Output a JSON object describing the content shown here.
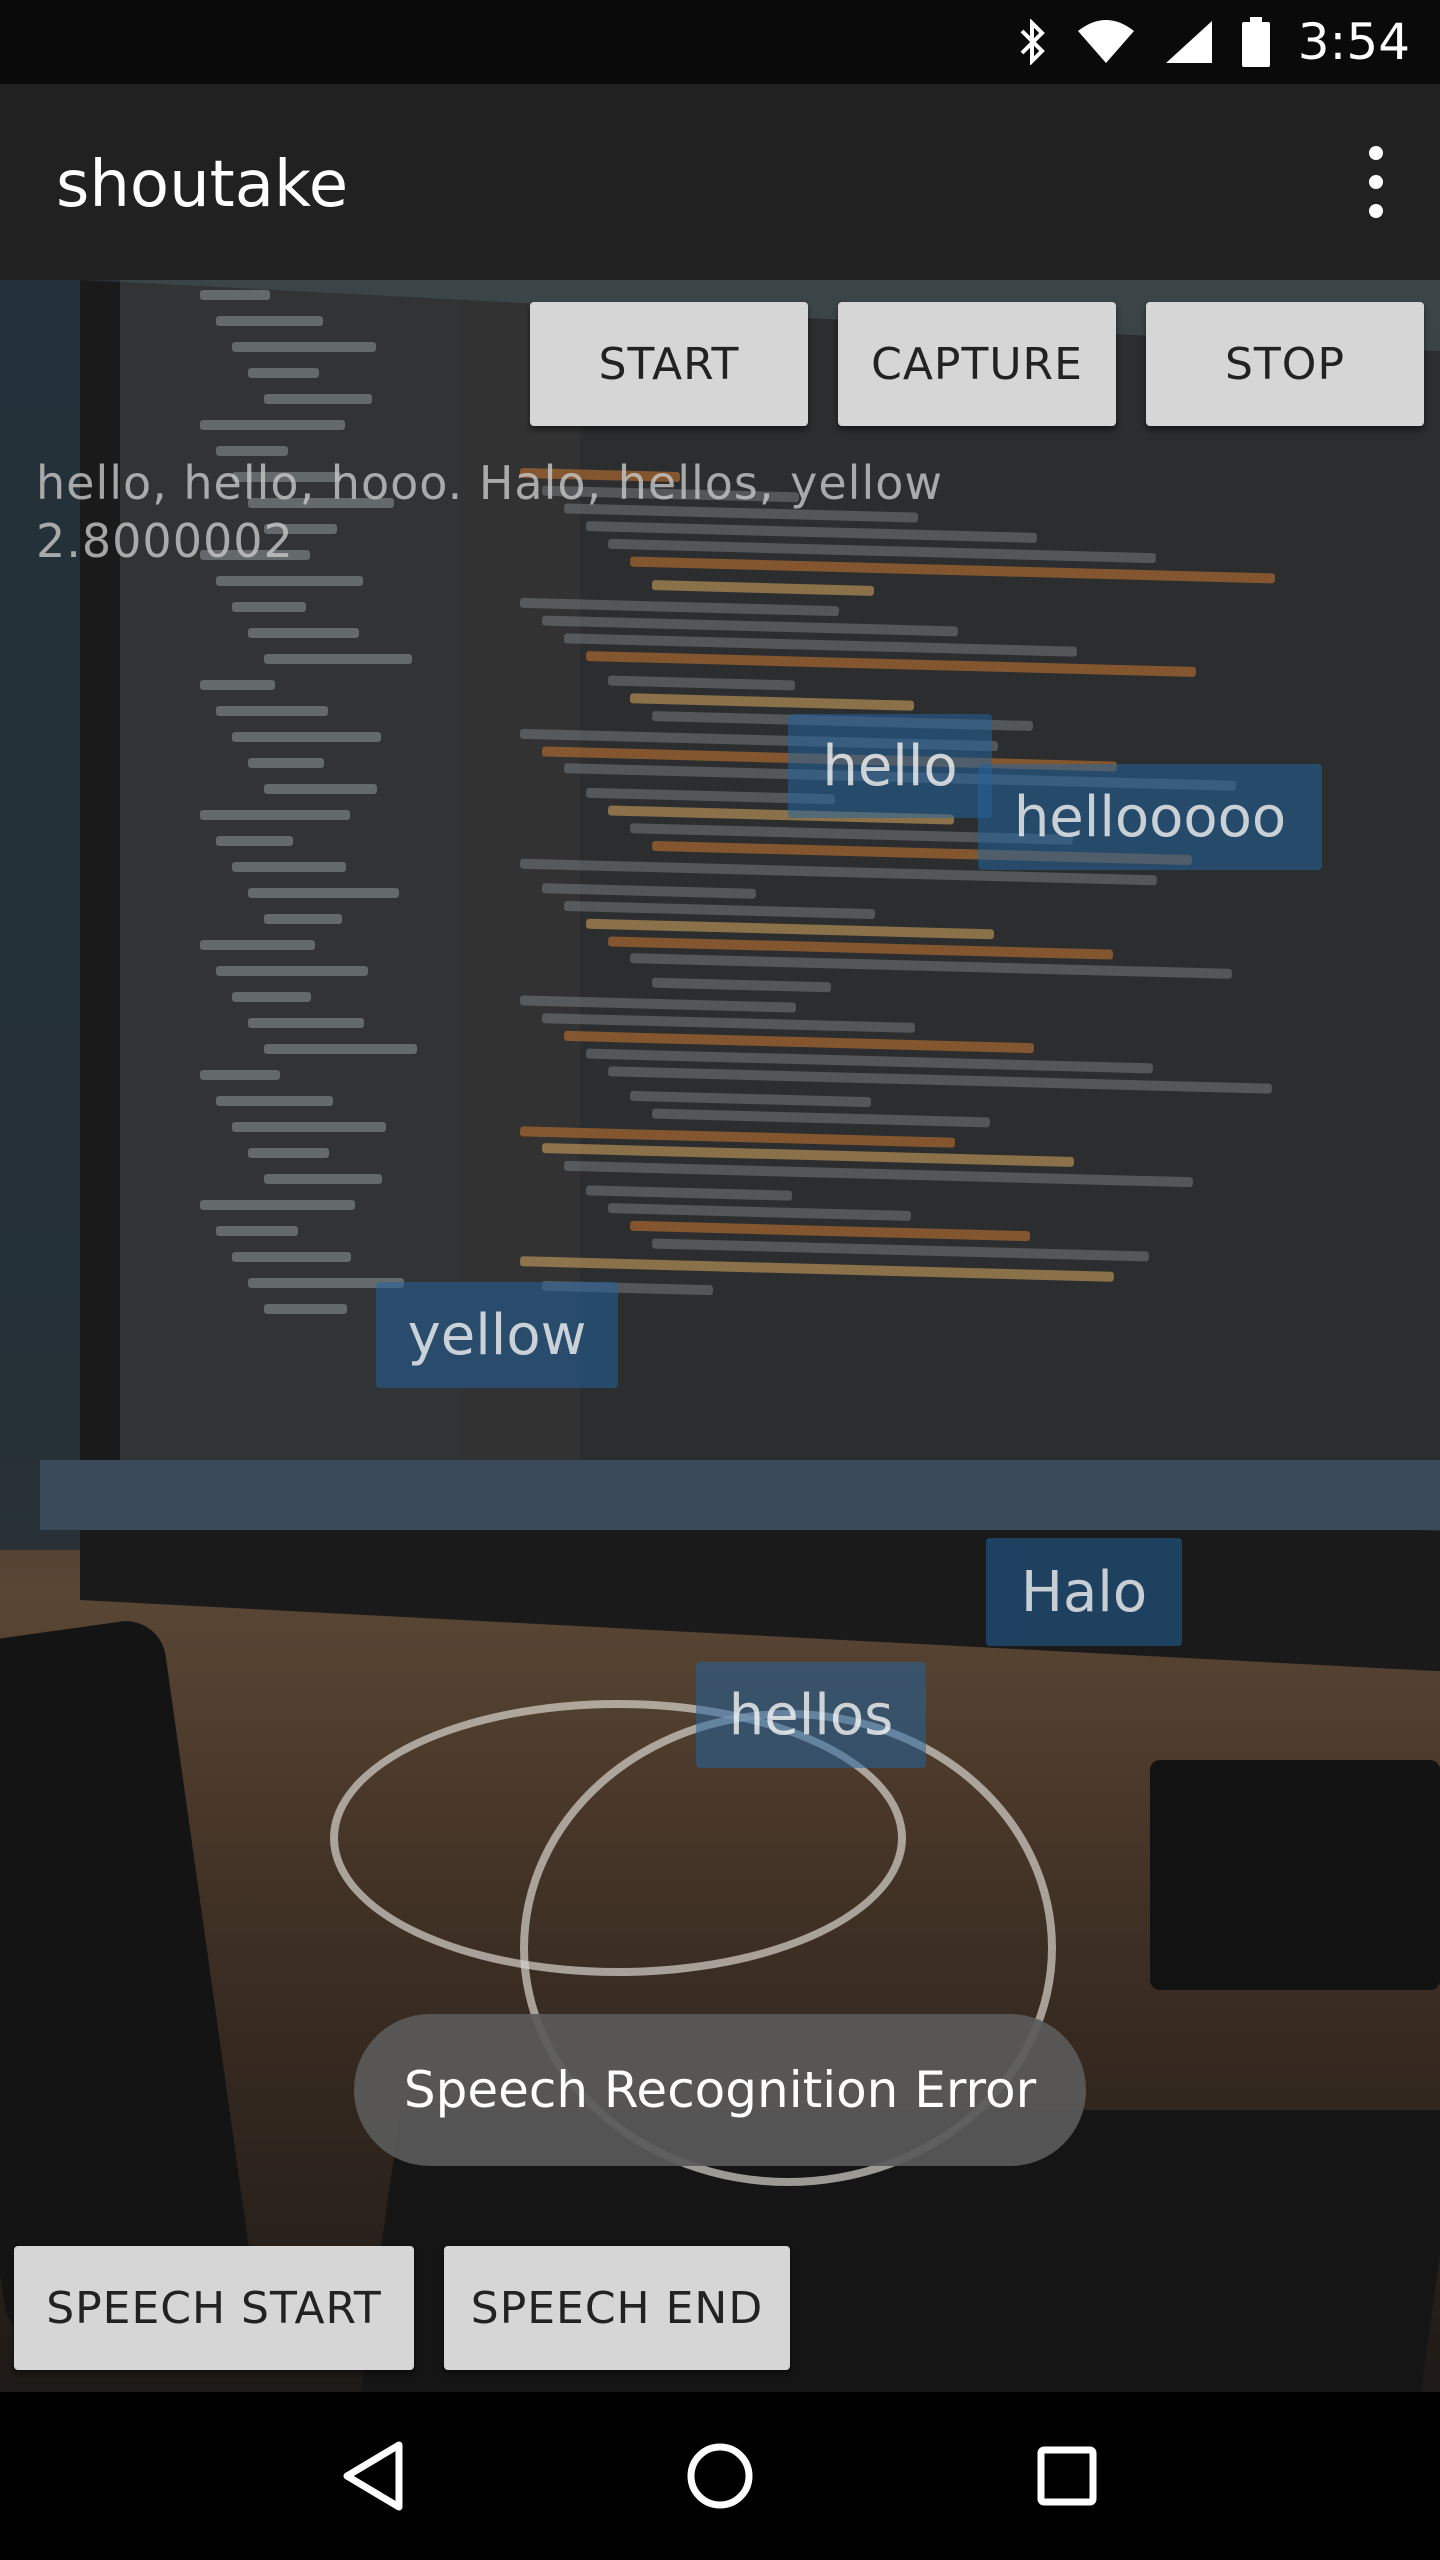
{
  "status_bar": {
    "time": "3:54",
    "icons": [
      "bluetooth-icon",
      "wifi-icon",
      "signal-icon",
      "battery-icon"
    ]
  },
  "app_bar": {
    "title": "shoutake",
    "overflow_icon": "overflow-menu-icon"
  },
  "controls": {
    "start_label": "START",
    "capture_label": "CAPTURE",
    "stop_label": "STOP"
  },
  "transcript": {
    "text": "hello, hello, hooo. Halo, hellos, yellow",
    "score": "2.8000002"
  },
  "floating_words": [
    "hello",
    "hellooooo",
    "yellow",
    "Halo",
    "hellos"
  ],
  "toast": {
    "message": "Speech Recognition Error"
  },
  "speech_controls": {
    "start_label": "SPEECH START",
    "end_label": "SPEECH END"
  },
  "nav_bar": {
    "back_icon": "back-icon",
    "home_icon": "home-icon",
    "recents_icon": "recents-icon"
  },
  "colors": {
    "app_bar": "#212121",
    "button_bg": "#d6d6d6",
    "floating_word_bg": "#23649f",
    "toast_bg": "#5a5a5a"
  }
}
